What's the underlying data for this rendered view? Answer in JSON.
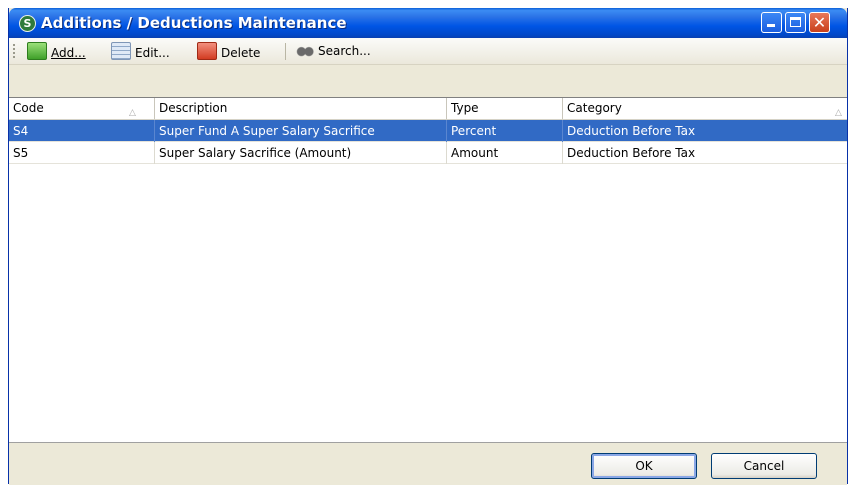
{
  "window": {
    "title": "Additions / Deductions Maintenance",
    "app_icon": "green-s-logo",
    "controls": {
      "minimize": "minimize-icon",
      "maximize": "maximize-icon",
      "close": "close-icon"
    }
  },
  "toolbar": {
    "add_label": "Add...",
    "edit_label": "Edit...",
    "delete_label": "Delete",
    "search_label": "Search..."
  },
  "table": {
    "columns": [
      "Code",
      "Description",
      "Type",
      "Category"
    ],
    "rows": [
      {
        "code": "S4",
        "description": "Super Fund A Super Salary Sacrifice",
        "type": "Percent",
        "category": "Deduction Before Tax",
        "selected": true
      },
      {
        "code": "S5",
        "description": "Super Salary Sacrifice (Amount)",
        "type": "Amount",
        "category": "Deduction Before Tax",
        "selected": false
      }
    ]
  },
  "footer": {
    "ok_label": "OK",
    "cancel_label": "Cancel"
  },
  "colors": {
    "titlebar": "#0055e5",
    "selection": "#316ac5",
    "face": "#ece9d8"
  }
}
